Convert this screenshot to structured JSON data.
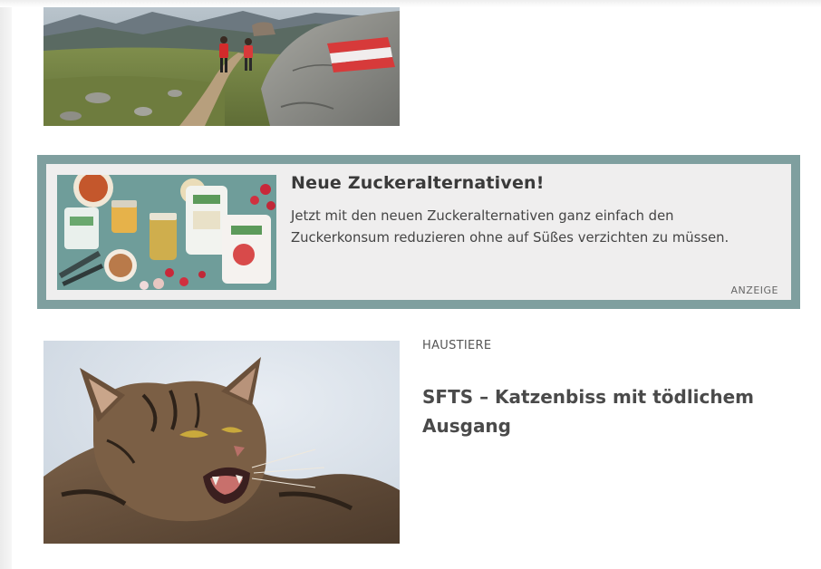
{
  "colors": {
    "ad_border": "#7f9f9f",
    "ad_background": "#efeeee",
    "headline": "#4a4a4a"
  },
  "teaser_top": {
    "image": "hiking-image"
  },
  "ad": {
    "image": "sugar-products-image",
    "title": "Neue Zuckeralternativen!",
    "text": "Jetzt mit den neuen Zuckeralternativen ganz einfach den Zuckerkonsum reduzieren ohne auf Süßes verzichten zu müssen.",
    "label": "ANZEIGE"
  },
  "article": {
    "image": "cat-image",
    "category": "HAUSTIERE",
    "headline": "SFTS – Katzenbiss mit tödlichem Ausgang"
  }
}
